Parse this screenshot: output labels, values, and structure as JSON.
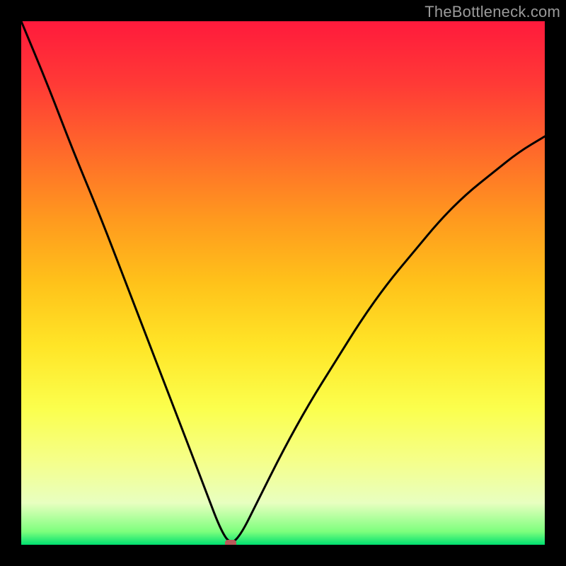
{
  "watermark": "TheBottleneck.com",
  "chart_data": {
    "type": "line",
    "title": "",
    "xlabel": "",
    "ylabel": "",
    "xlim": [
      0,
      100
    ],
    "ylim": [
      0,
      100
    ],
    "gradient_meaning": "background vertical gradient: red (top, high bottleneck) to green (bottom, optimal)",
    "series": [
      {
        "name": "bottleneck-curve",
        "x": [
          0,
          5,
          10,
          15,
          20,
          25,
          30,
          35,
          38,
          40,
          42,
          45,
          50,
          55,
          60,
          65,
          70,
          75,
          80,
          85,
          90,
          95,
          100
        ],
        "y": [
          100,
          88,
          75,
          63,
          50,
          37,
          24,
          11,
          3,
          0,
          2,
          8,
          18,
          27,
          35,
          43,
          50,
          56,
          62,
          67,
          71,
          75,
          78
        ]
      }
    ],
    "marker": {
      "name": "optimal-point",
      "x": 40,
      "y": 0,
      "color": "#b85a5a"
    }
  }
}
